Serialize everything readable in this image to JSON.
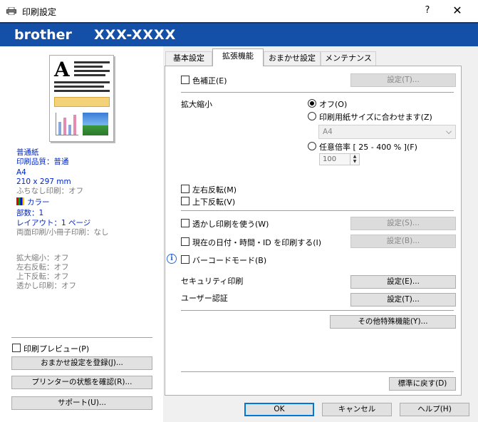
{
  "window": {
    "title": "印刷設定",
    "help_label": "?",
    "close_label": "✕"
  },
  "banner": {
    "brand": "brother",
    "model": "XXX-XXXX"
  },
  "summary": {
    "media": "普通紙",
    "quality": "印刷品質：普通",
    "paper": "A4",
    "size": "210 x 297 mm",
    "borderless": "ふちなし印刷：オフ",
    "color": "カラー",
    "copies": "部数：1",
    "layout": "レイアウト：1 ページ",
    "duplex": "両面印刷/小冊子印刷：なし",
    "scaling": "拡大縮小：オフ",
    "mirror": "左右反転：オフ",
    "reverse": "上下反転：オフ",
    "watermark": "透かし印刷：オフ"
  },
  "left_controls": {
    "preview_label": "印刷プレビュー(P)",
    "register_profile": "おまかせ設定を登録(J)...",
    "printer_status": "プリンターの状態を確認(R)...",
    "support": "サポート(U)..."
  },
  "tabs": [
    "基本設定",
    "拡張機能",
    "おまかせ設定",
    "メンテナンス"
  ],
  "active_tab": "拡張機能",
  "advanced": {
    "color_correction": "色補正(E)",
    "color_settings": "設定(T)...",
    "scaling_label": "拡大縮小",
    "scaling_off": "オフ(O)",
    "fit_to_paper": "印刷用紙サイズに合わせます(Z)",
    "paper_value": "A4",
    "custom_ratio": "任意倍率 [ 25 - 400 % ](F)",
    "ratio_value": "100",
    "mirror": "左右反転(M)",
    "reverse": "上下反転(V)",
    "watermark": "透かし印刷を使う(W)",
    "watermark_settings": "設定(S)...",
    "header_footer": "現在の日付・時間・ID を印刷する(I)",
    "header_footer_settings": "設定(B)...",
    "barcode": "バーコードモード(B)",
    "secure_print": "セキュリティ印刷",
    "secure_settings": "設定(E)...",
    "user_auth": "ユーザー認証",
    "user_auth_settings": "設定(T)...",
    "other_features": "その他特殊機能(Y)...",
    "default": "標準に戻す(D)"
  },
  "footer": {
    "ok": "OK",
    "cancel": "キャンセル",
    "help": "ヘルプ(H)"
  },
  "colors": {
    "banner": "#1450a8",
    "summary_blue": "#0026c8",
    "summary_gray": "#7a7a7a"
  }
}
